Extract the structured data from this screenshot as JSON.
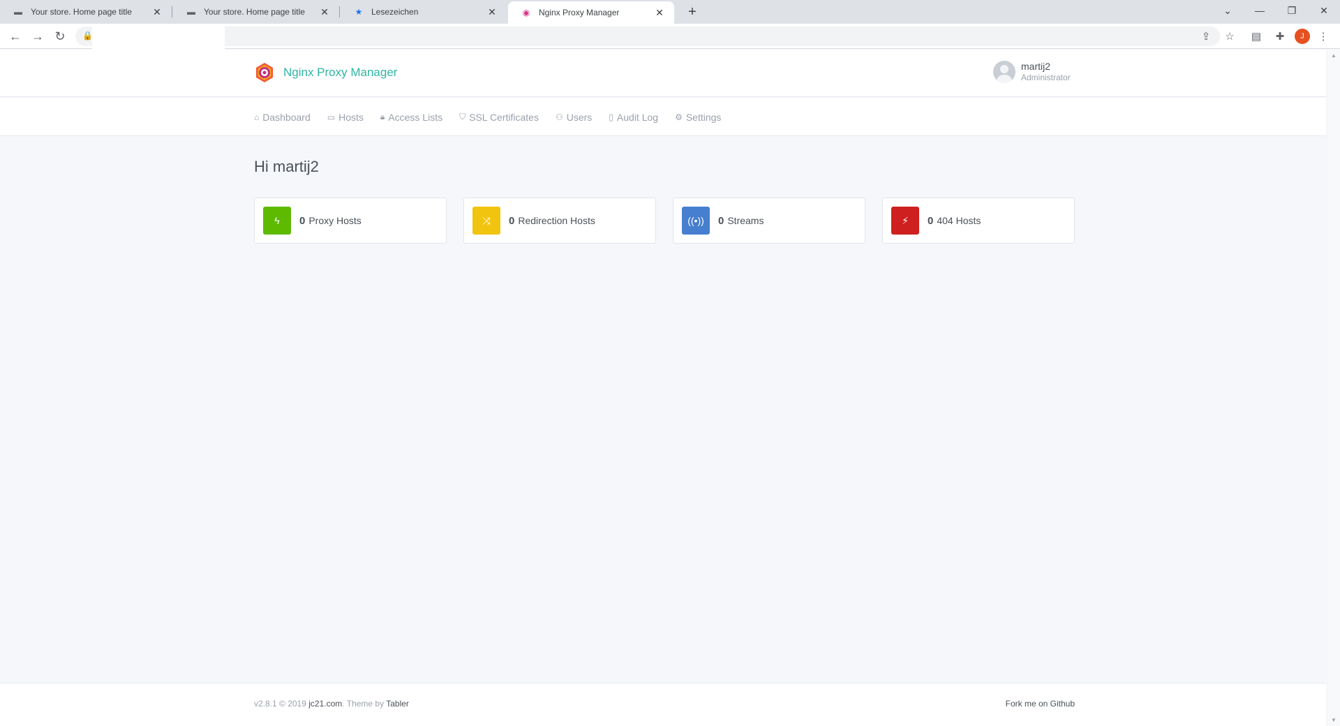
{
  "browser": {
    "tabs": [
      {
        "title": "Your store. Home page title",
        "icon": "store-favicon"
      },
      {
        "title": "Your store. Home page title",
        "icon": "store-favicon"
      },
      {
        "title": "Lesezeichen",
        "icon": "star-icon"
      },
      {
        "title": "Nginx Proxy Manager",
        "icon": "npm-logo",
        "active": true
      }
    ],
    "new_tab": "+",
    "window_controls": {
      "dropdown": "⌄",
      "minimize": "—",
      "restore": "❐",
      "close": "✕"
    },
    "profile_initial": "J"
  },
  "app": {
    "brand": "Nginx Proxy Manager",
    "user": {
      "name": "martij2",
      "role": "Administrator"
    },
    "nav": [
      {
        "label": "Dashboard",
        "icon": "home-icon"
      },
      {
        "label": "Hosts",
        "icon": "monitor-icon"
      },
      {
        "label": "Access Lists",
        "icon": "lock-icon"
      },
      {
        "label": "SSL Certificates",
        "icon": "shield-icon"
      },
      {
        "label": "Users",
        "icon": "users-icon"
      },
      {
        "label": "Audit Log",
        "icon": "book-icon"
      },
      {
        "label": "Settings",
        "icon": "gear-icon"
      }
    ],
    "greeting": "Hi martij2",
    "stats": [
      {
        "count": "0",
        "label": "Proxy Hosts",
        "icon": "zap-icon",
        "color": "#5eba00"
      },
      {
        "count": "0",
        "label": "Redirection Hosts",
        "icon": "shuffle-icon",
        "color": "#f1c40f"
      },
      {
        "count": "0",
        "label": "Streams",
        "icon": "radio-icon",
        "color": "#467fcf"
      },
      {
        "count": "0",
        "label": "404 Hosts",
        "icon": "zap-off-icon",
        "color": "#cd201f"
      }
    ],
    "footer": {
      "version": "v2.8.1 © 2019",
      "author": "jc21.com",
      "theme_by": ". Theme by",
      "theme": "Tabler",
      "github": "Fork me on Github"
    }
  }
}
